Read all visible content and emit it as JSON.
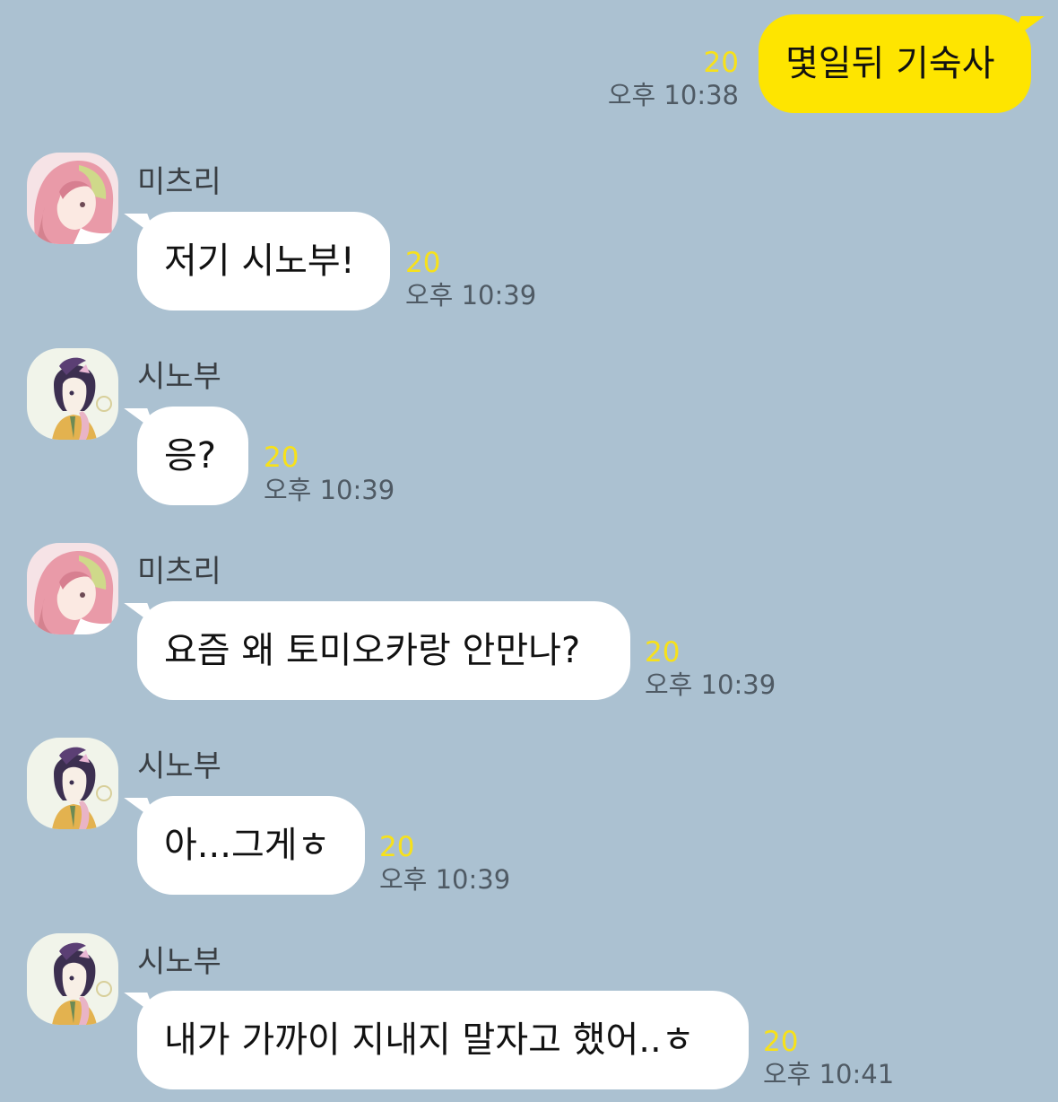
{
  "colors": {
    "background": "#abc1d1",
    "bubble_in": "#ffffff",
    "bubble_out": "#fee500",
    "unread": "#f7e11a",
    "time": "#4f5a64"
  },
  "messages": [
    {
      "direction": "out",
      "text": "몇일뒤 기숙사",
      "unread": "20",
      "time": "오후 10:38"
    },
    {
      "direction": "in",
      "sender": "미츠리",
      "avatar": "mitsuri-avatar",
      "text": "저기 시노부!",
      "unread": "20",
      "time": "오후 10:39"
    },
    {
      "direction": "in",
      "sender": "시노부",
      "avatar": "shinobu-avatar",
      "text": "응?",
      "unread": "20",
      "time": "오후 10:39"
    },
    {
      "direction": "in",
      "sender": "미츠리",
      "avatar": "mitsuri-avatar",
      "text": "요즘 왜 토미오카랑 안만나?",
      "unread": "20",
      "time": "오후 10:39"
    },
    {
      "direction": "in",
      "sender": "시노부",
      "avatar": "shinobu-avatar",
      "text": "아...그게ㅎ",
      "unread": "20",
      "time": "오후 10:39"
    },
    {
      "direction": "in",
      "sender": "시노부",
      "avatar": "shinobu-avatar",
      "text": "내가 가까이 지내지 말자고 했어..ㅎ",
      "unread": "20",
      "time": "오후 10:41"
    }
  ]
}
